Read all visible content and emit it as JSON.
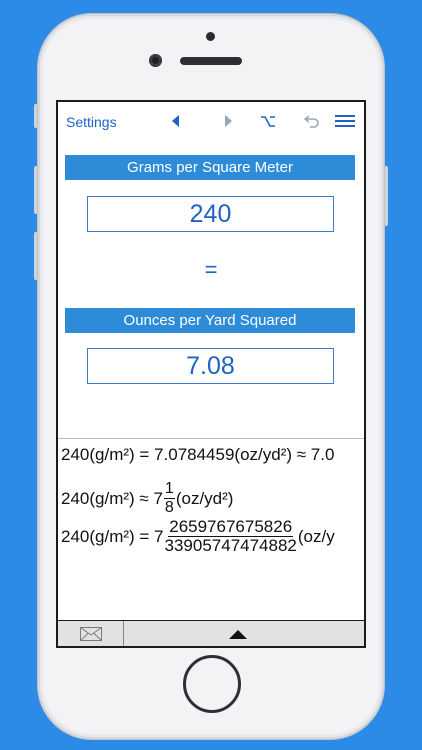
{
  "toolbar": {
    "settings_label": "Settings",
    "prev_icon": "triangle-left-icon",
    "next_icon": "triangle-right-icon",
    "alt_icon": "option-key-icon",
    "undo_icon": "undo-icon",
    "menu_icon": "hamburger-menu-icon"
  },
  "converter": {
    "from_unit": "Grams per Square Meter",
    "from_value": "240",
    "equals_sign": "=",
    "to_unit": "Ounces per Yard Squared",
    "to_value": "7.08"
  },
  "results": {
    "line1": "240(g/m²) = 7.0784459(oz/yd²) ≈ 7.0",
    "line2_prefix": "240(g/m²) ≈ 7",
    "line2_num": "1",
    "line2_den": "8",
    "line2_suffix": "(oz/yd²)",
    "line3_prefix": "240(g/m²) = 7",
    "line3_num": "2659767675826",
    "line3_den": "33905747474882",
    "line3_suffix": "(oz/y"
  },
  "bottombar": {
    "mail_icon": "mail-envelope-icon",
    "expand_icon": "triangle-up-icon"
  },
  "colors": {
    "background": "#2b8be6",
    "accent_blue": "#1e63c4",
    "unit_bar": "#2e8bd8"
  }
}
